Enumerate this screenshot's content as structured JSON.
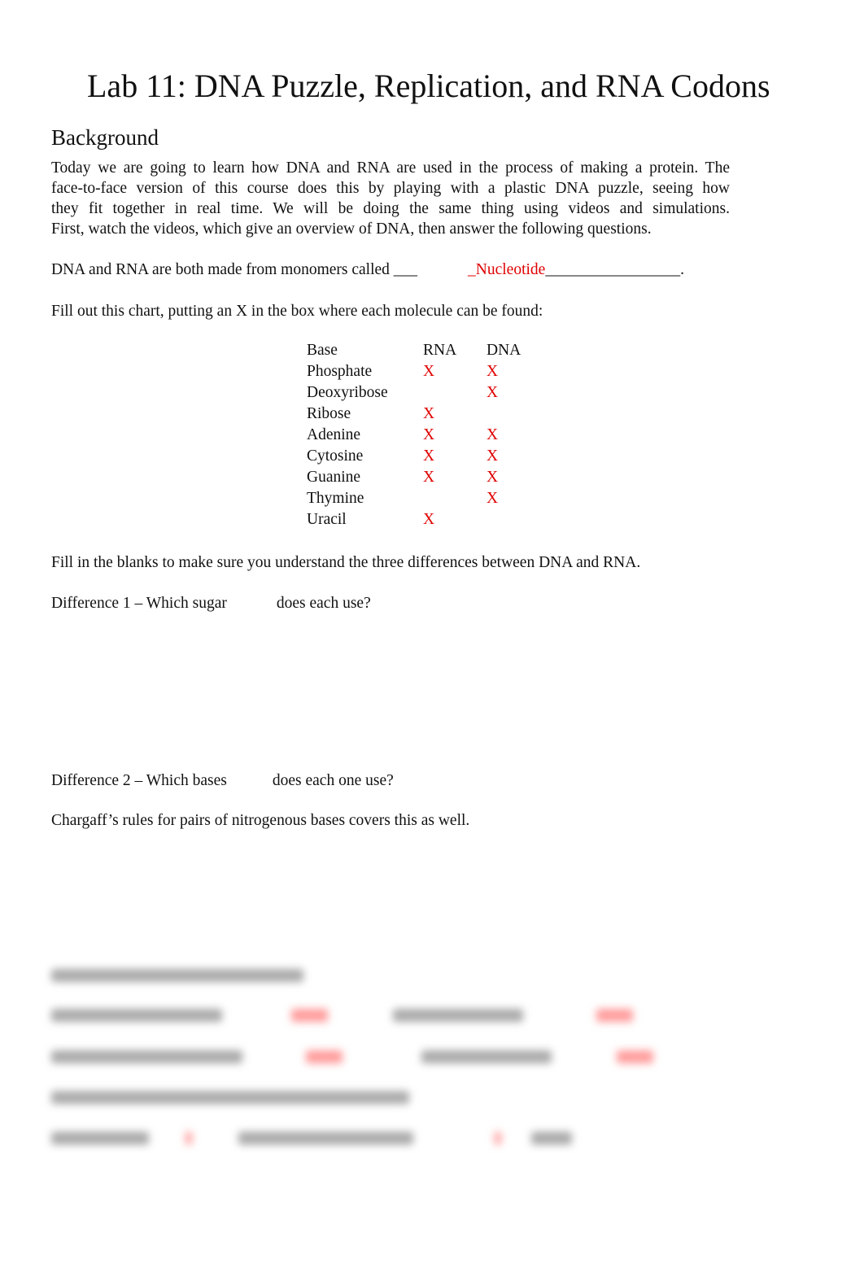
{
  "title": "Lab 11: DNA Puzzle, Replication, and RNA Codons",
  "section_heading": "Background",
  "intro_lines": [
    "Today we are going to learn how DNA and RNA are used in the process of making a protein. The",
    "face-to-face version of this course does this by playing with a plastic DNA puzzle, seeing how",
    "they fit together in real time. We will be doing the same thing using videos and simulations.",
    "First, watch the videos, which give an overview of DNA, then answer the following questions."
  ],
  "monomer_question": {
    "prefix": "DNA and RNA are both made from monomers called ___",
    "answer": "_Nucleotide",
    "suffix": "_________________."
  },
  "chart_instruction": "Fill out this chart, putting an X in the box where each molecule can be found:",
  "chart": {
    "headers": [
      "Base",
      "RNA",
      "DNA"
    ],
    "rows": [
      {
        "name": "Phosphate",
        "rna": "X",
        "dna": "X"
      },
      {
        "name": "Deoxyribose",
        "rna": "",
        "dna": "X"
      },
      {
        "name": "Ribose",
        "rna": "X",
        "dna": ""
      },
      {
        "name": "Adenine",
        "rna": "X",
        "dna": "X"
      },
      {
        "name": "Cytosine",
        "rna": "X",
        "dna": "X"
      },
      {
        "name": "Guanine",
        "rna": "X",
        "dna": "X"
      },
      {
        "name": "Thymine",
        "rna": "",
        "dna": "X"
      },
      {
        "name": "Uracil",
        "rna": "X",
        "dna": ""
      }
    ]
  },
  "differences_instruction": "Fill in the blanks to make sure you understand the three differences between DNA and RNA.",
  "difference1": {
    "a": "Difference 1 – Which sugar",
    "b": "does each use?"
  },
  "difference2": {
    "a": "Difference 2 – Which bases",
    "b": "does each one use?"
  },
  "chargaff": "Chargaff’s rules for pairs of nitrogenous bases covers this as well.",
  "colors": {
    "answer": "#e00000",
    "text": "#111111"
  }
}
